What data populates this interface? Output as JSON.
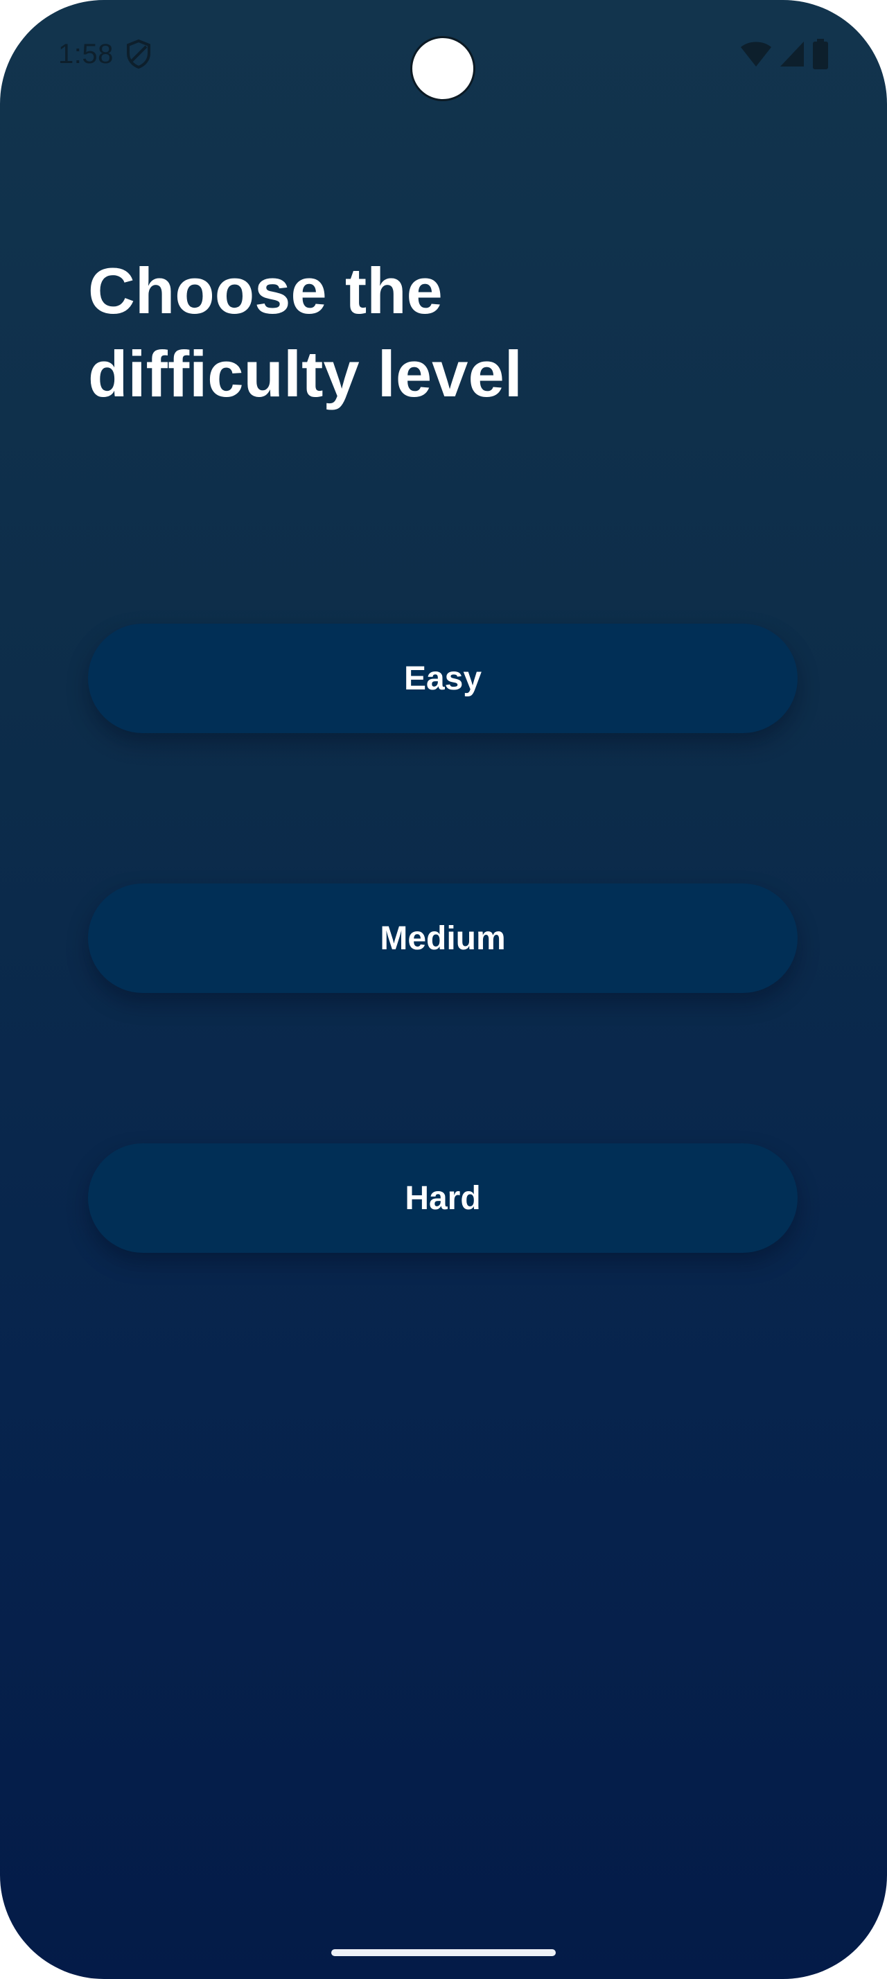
{
  "status_bar": {
    "time": "1:58",
    "icons": [
      "shield-icon",
      "wifi-icon",
      "signal-icon",
      "battery-icon"
    ]
  },
  "screen": {
    "title": "Choose the\ndifficulty level",
    "buttons": [
      {
        "label": "Easy"
      },
      {
        "label": "Medium"
      },
      {
        "label": "Hard"
      }
    ]
  },
  "colors": {
    "background_top": "#12344d",
    "background_bottom": "#041b48",
    "button": "#012f56",
    "text": "#ffffff"
  }
}
